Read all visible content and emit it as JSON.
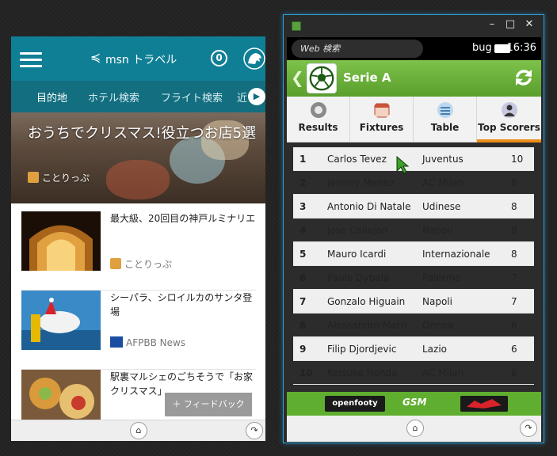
{
  "left_window": {
    "app_name": "msn トラベル",
    "back_glyph": "≼",
    "badge_count": "0",
    "tabs": [
      {
        "label": "目的地",
        "active": true
      },
      {
        "label": "ホテル検索",
        "active": false
      },
      {
        "label": "フライト検索",
        "active": false
      },
      {
        "label": "近",
        "active": false
      }
    ],
    "hero": {
      "title": "おうちでクリスマス!役立つお店5選",
      "source": "ことりっぷ"
    },
    "news": [
      {
        "title": "最大級、20回目の神戸ルミナリエ",
        "source": "ことりっぷ"
      },
      {
        "title": "シーパラ、シロイルカのサンタ登場",
        "source": "AFPBB News"
      },
      {
        "title": "駅裏マルシェのごちそうで「お家クリスマス」",
        "source": ""
      }
    ],
    "feedback_label": "＋ フィードバック"
  },
  "right_window": {
    "status": {
      "search_placeholder": "Web 検索",
      "carrier": "bug",
      "time": "16:36"
    },
    "header": {
      "title": "Serie A"
    },
    "tabs": [
      {
        "label": "Results",
        "active": false
      },
      {
        "label": "Fixtures",
        "active": false
      },
      {
        "label": "Table",
        "active": false
      },
      {
        "label": "Top Scorers",
        "active": true
      }
    ],
    "scorers": [
      {
        "rank": "1",
        "name": "Carlos Tevez",
        "team": "Juventus",
        "goals": "10"
      },
      {
        "rank": "2",
        "name": "Jeremy Menez",
        "team": "AC Milan",
        "goals": "8"
      },
      {
        "rank": "3",
        "name": "Antonio Di Natale",
        "team": "Udinese",
        "goals": "8"
      },
      {
        "rank": "4",
        "name": "Jose Callejon",
        "team": "Napoli",
        "goals": "8"
      },
      {
        "rank": "5",
        "name": "Mauro Icardi",
        "team": "Internazionale",
        "goals": "8"
      },
      {
        "rank": "6",
        "name": "Paulo Dybala",
        "team": "Palermo",
        "goals": "7"
      },
      {
        "rank": "7",
        "name": "Gonzalo Higuain",
        "team": "Napoli",
        "goals": "7"
      },
      {
        "rank": "8",
        "name": "Alessandro Matri",
        "team": "Genoa",
        "goals": "6"
      },
      {
        "rank": "9",
        "name": "Filip Djordjevic",
        "team": "Lazio",
        "goals": "6"
      },
      {
        "rank": "10",
        "name": "Keisuke Honda",
        "team": "AC Milan",
        "goals": "6"
      }
    ],
    "footer": {
      "openfooty": "openfooty",
      "gsm": "GSM"
    }
  },
  "colors": {
    "msn_teal": "#0f7f95",
    "msn_tabbar": "#136e80",
    "app_green": "#5fae2f",
    "tab_underline": "#ec8e1a",
    "window_border": "#2f9fd8"
  }
}
